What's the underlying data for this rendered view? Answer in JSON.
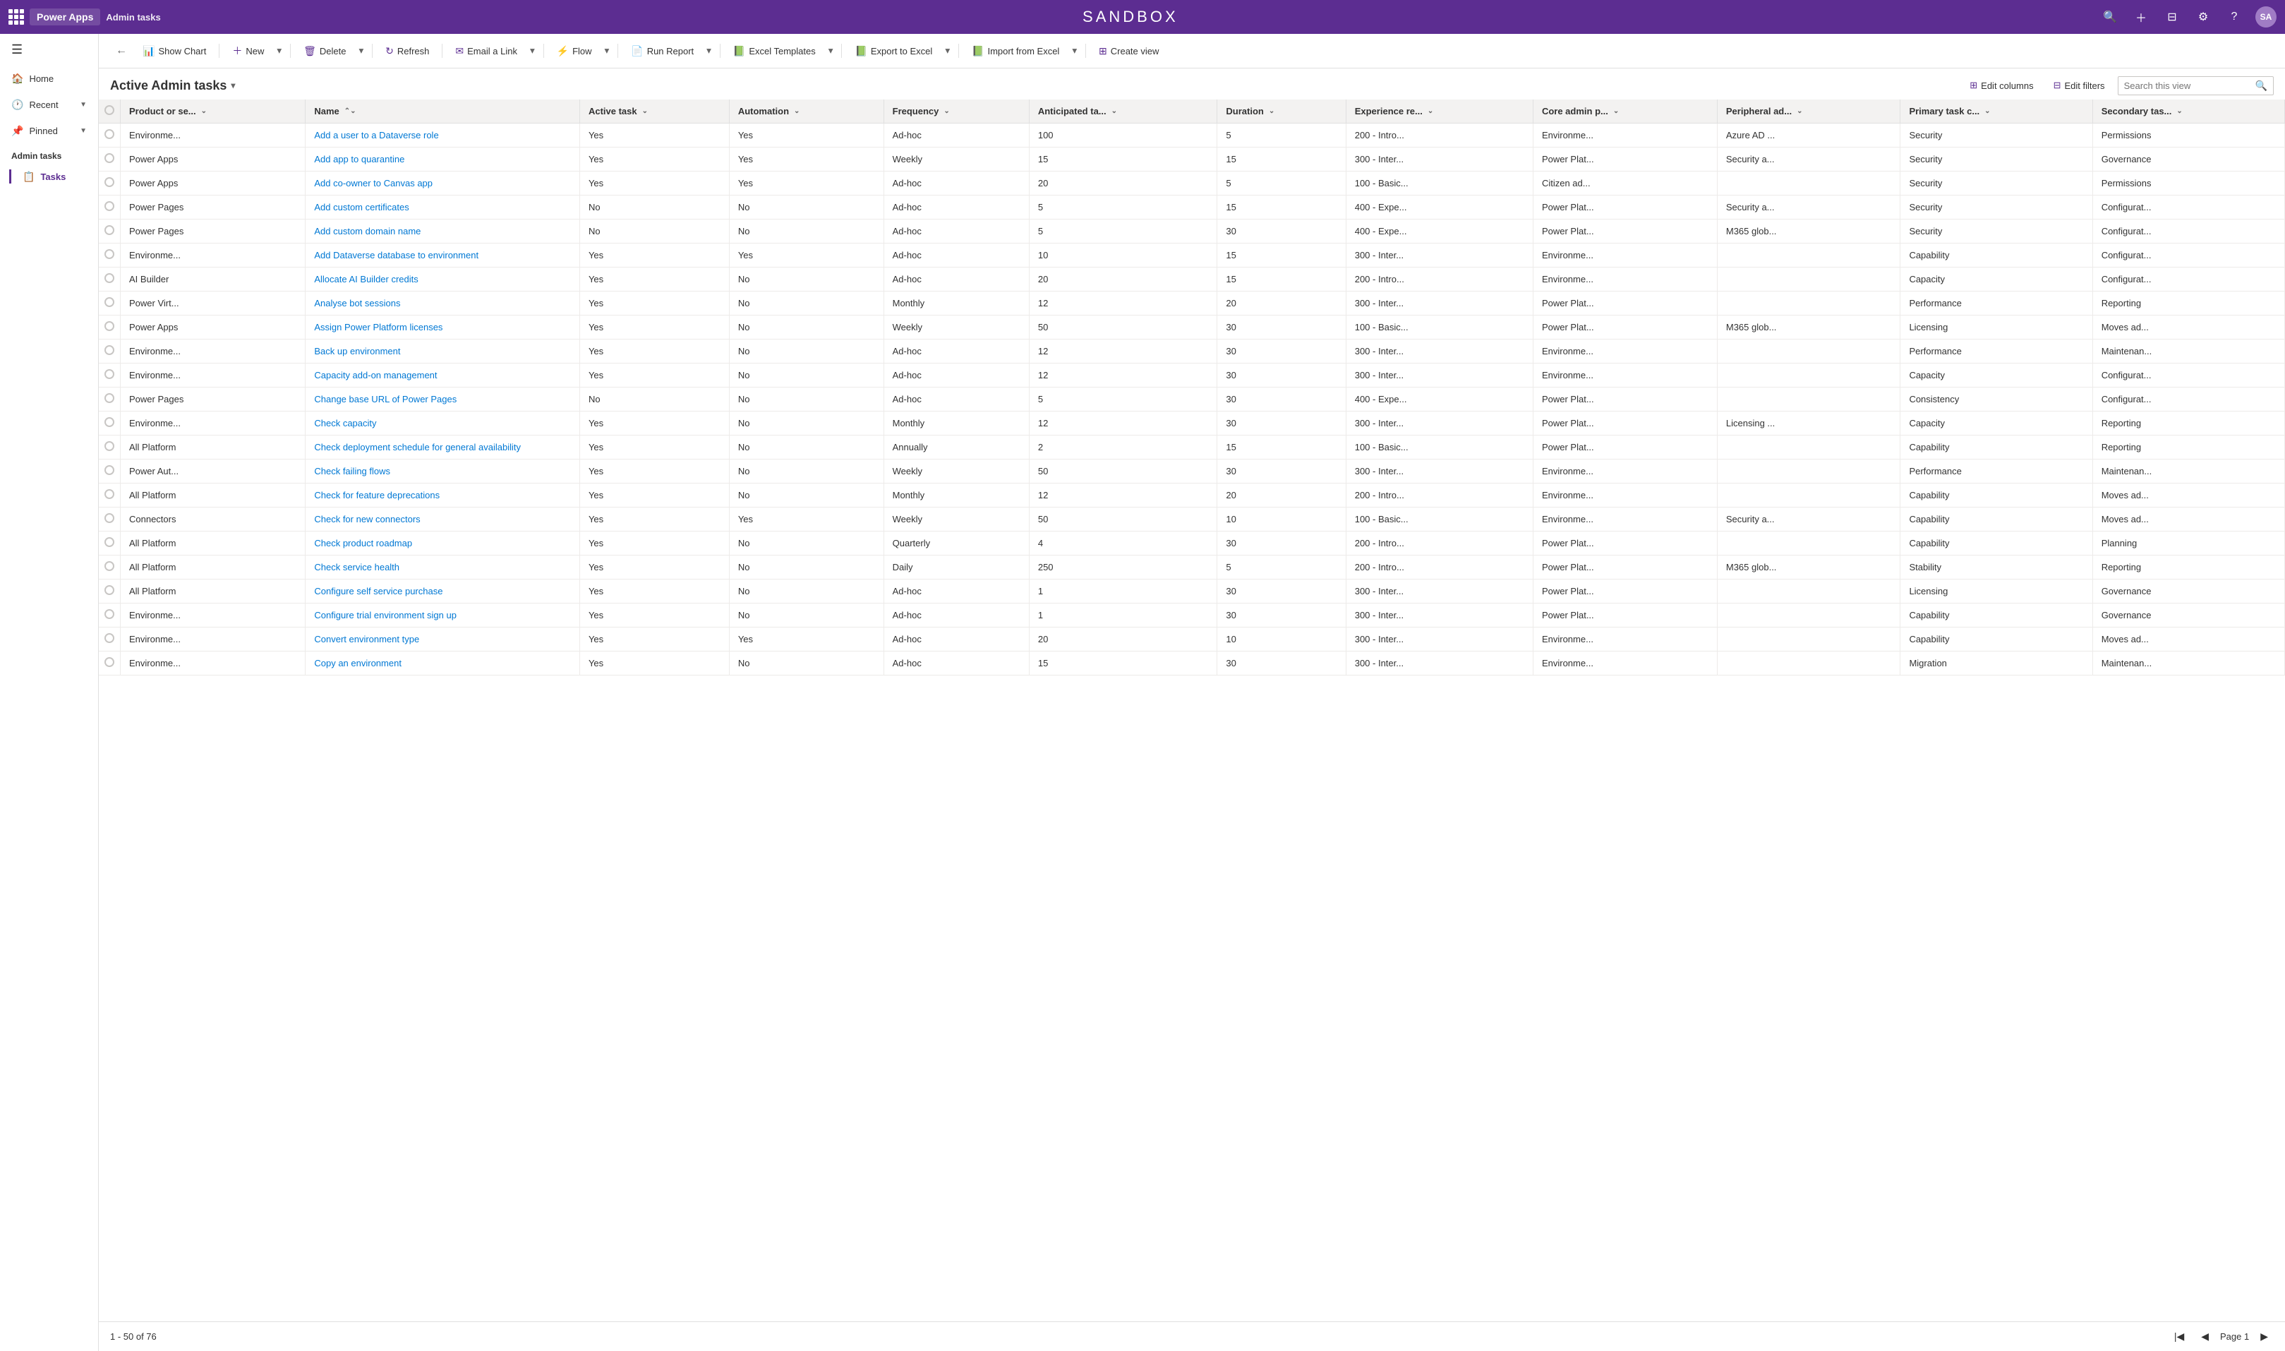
{
  "app": {
    "title": "Power Apps",
    "environment": "SANDBOX",
    "avatar_initials": "SA"
  },
  "topbar": {
    "search_icon": "🔍",
    "add_icon": "+",
    "filter_icon": "⚙",
    "settings_icon": "⚙",
    "help_icon": "?"
  },
  "sidebar": {
    "toggle": "☰",
    "nav_items": [
      {
        "id": "home",
        "icon": "🏠",
        "label": "Home"
      },
      {
        "id": "recent",
        "icon": "🕐",
        "label": "Recent",
        "has_chevron": true
      },
      {
        "id": "pinned",
        "icon": "📌",
        "label": "Pinned",
        "has_chevron": true
      }
    ],
    "section_label": "Admin tasks",
    "sub_items": [
      {
        "id": "tasks",
        "label": "Tasks",
        "active": true,
        "has_icon": true
      }
    ]
  },
  "command_bar": {
    "back": "←",
    "show_chart": "Show Chart",
    "new": "New",
    "delete": "Delete",
    "refresh": "Refresh",
    "email_link": "Email a Link",
    "flow": "Flow",
    "run_report": "Run Report",
    "excel_templates": "Excel Templates",
    "export_to_excel": "Export to Excel",
    "import_from_excel": "Import from Excel",
    "create_view": "Create view"
  },
  "view": {
    "title": "Active Admin tasks",
    "edit_columns": "Edit columns",
    "edit_filters": "Edit filters",
    "search_placeholder": "Search this view"
  },
  "table": {
    "columns": [
      {
        "id": "product",
        "label": "Product or se..."
      },
      {
        "id": "name",
        "label": "Name"
      },
      {
        "id": "active_task",
        "label": "Active task"
      },
      {
        "id": "automation",
        "label": "Automation"
      },
      {
        "id": "frequency",
        "label": "Frequency"
      },
      {
        "id": "anticipated",
        "label": "Anticipated ta..."
      },
      {
        "id": "duration",
        "label": "Duration"
      },
      {
        "id": "experience",
        "label": "Experience re..."
      },
      {
        "id": "core_admin",
        "label": "Core admin p..."
      },
      {
        "id": "peripheral",
        "label": "Peripheral ad..."
      },
      {
        "id": "primary_task",
        "label": "Primary task c..."
      },
      {
        "id": "secondary_task",
        "label": "Secondary tas..."
      }
    ],
    "rows": [
      {
        "product": "Environme...",
        "name": "Add a user to a Dataverse role",
        "active_task": "Yes",
        "automation": "Yes",
        "frequency": "Ad-hoc",
        "anticipated": "100",
        "duration": "5",
        "experience": "200 - Intro...",
        "core_admin": "Environme...",
        "peripheral": "Azure AD ...",
        "primary_task": "Security",
        "secondary_task": "Permissions"
      },
      {
        "product": "Power Apps",
        "name": "Add app to quarantine",
        "active_task": "Yes",
        "automation": "Yes",
        "frequency": "Weekly",
        "anticipated": "15",
        "duration": "15",
        "experience": "300 - Inter...",
        "core_admin": "Power Plat...",
        "peripheral": "Security a...",
        "primary_task": "Security",
        "secondary_task": "Governance"
      },
      {
        "product": "Power Apps",
        "name": "Add co-owner to Canvas app",
        "active_task": "Yes",
        "automation": "Yes",
        "frequency": "Ad-hoc",
        "anticipated": "20",
        "duration": "5",
        "experience": "100 - Basic...",
        "core_admin": "Citizen ad...",
        "peripheral": "",
        "primary_task": "Security",
        "secondary_task": "Permissions"
      },
      {
        "product": "Power Pages",
        "name": "Add custom certificates",
        "active_task": "No",
        "automation": "No",
        "frequency": "Ad-hoc",
        "anticipated": "5",
        "duration": "15",
        "experience": "400 - Expe...",
        "core_admin": "Power Plat...",
        "peripheral": "Security a...",
        "primary_task": "Security",
        "secondary_task": "Configurat..."
      },
      {
        "product": "Power Pages",
        "name": "Add custom domain name",
        "active_task": "No",
        "automation": "No",
        "frequency": "Ad-hoc",
        "anticipated": "5",
        "duration": "30",
        "experience": "400 - Expe...",
        "core_admin": "Power Plat...",
        "peripheral": "M365 glob...",
        "primary_task": "Security",
        "secondary_task": "Configurat..."
      },
      {
        "product": "Environme...",
        "name": "Add Dataverse database to environment",
        "active_task": "Yes",
        "automation": "Yes",
        "frequency": "Ad-hoc",
        "anticipated": "10",
        "duration": "15",
        "experience": "300 - Inter...",
        "core_admin": "Environme...",
        "peripheral": "",
        "primary_task": "Capability",
        "secondary_task": "Configurat..."
      },
      {
        "product": "AI Builder",
        "name": "Allocate AI Builder credits",
        "active_task": "Yes",
        "automation": "No",
        "frequency": "Ad-hoc",
        "anticipated": "20",
        "duration": "15",
        "experience": "200 - Intro...",
        "core_admin": "Environme...",
        "peripheral": "",
        "primary_task": "Capacity",
        "secondary_task": "Configurat..."
      },
      {
        "product": "Power Virt...",
        "name": "Analyse bot sessions",
        "active_task": "Yes",
        "automation": "No",
        "frequency": "Monthly",
        "anticipated": "12",
        "duration": "20",
        "experience": "300 - Inter...",
        "core_admin": "Power Plat...",
        "peripheral": "",
        "primary_task": "Performance",
        "secondary_task": "Reporting"
      },
      {
        "product": "Power Apps",
        "name": "Assign Power Platform licenses",
        "active_task": "Yes",
        "automation": "No",
        "frequency": "Weekly",
        "anticipated": "50",
        "duration": "30",
        "experience": "100 - Basic...",
        "core_admin": "Power Plat...",
        "peripheral": "M365 glob...",
        "primary_task": "Licensing",
        "secondary_task": "Moves ad..."
      },
      {
        "product": "Environme...",
        "name": "Back up environment",
        "active_task": "Yes",
        "automation": "No",
        "frequency": "Ad-hoc",
        "anticipated": "12",
        "duration": "30",
        "experience": "300 - Inter...",
        "core_admin": "Environme...",
        "peripheral": "",
        "primary_task": "Performance",
        "secondary_task": "Maintenan..."
      },
      {
        "product": "Environme...",
        "name": "Capacity add-on management",
        "active_task": "Yes",
        "automation": "No",
        "frequency": "Ad-hoc",
        "anticipated": "12",
        "duration": "30",
        "experience": "300 - Inter...",
        "core_admin": "Environme...",
        "peripheral": "",
        "primary_task": "Capacity",
        "secondary_task": "Configurat..."
      },
      {
        "product": "Power Pages",
        "name": "Change base URL of Power Pages",
        "active_task": "No",
        "automation": "No",
        "frequency": "Ad-hoc",
        "anticipated": "5",
        "duration": "30",
        "experience": "400 - Expe...",
        "core_admin": "Power Plat...",
        "peripheral": "",
        "primary_task": "Consistency",
        "secondary_task": "Configurat..."
      },
      {
        "product": "Environme...",
        "name": "Check capacity",
        "active_task": "Yes",
        "automation": "No",
        "frequency": "Monthly",
        "anticipated": "12",
        "duration": "30",
        "experience": "300 - Inter...",
        "core_admin": "Power Plat...",
        "peripheral": "Licensing ...",
        "primary_task": "Capacity",
        "secondary_task": "Reporting"
      },
      {
        "product": "All Platform",
        "name": "Check deployment schedule for general availability",
        "active_task": "Yes",
        "automation": "No",
        "frequency": "Annually",
        "anticipated": "2",
        "duration": "15",
        "experience": "100 - Basic...",
        "core_admin": "Power Plat...",
        "peripheral": "",
        "primary_task": "Capability",
        "secondary_task": "Reporting"
      },
      {
        "product": "Power Aut...",
        "name": "Check failing flows",
        "active_task": "Yes",
        "automation": "No",
        "frequency": "Weekly",
        "anticipated": "50",
        "duration": "30",
        "experience": "300 - Inter...",
        "core_admin": "Environme...",
        "peripheral": "",
        "primary_task": "Performance",
        "secondary_task": "Maintenan..."
      },
      {
        "product": "All Platform",
        "name": "Check for feature deprecations",
        "active_task": "Yes",
        "automation": "No",
        "frequency": "Monthly",
        "anticipated": "12",
        "duration": "20",
        "experience": "200 - Intro...",
        "core_admin": "Environme...",
        "peripheral": "",
        "primary_task": "Capability",
        "secondary_task": "Moves ad..."
      },
      {
        "product": "Connectors",
        "name": "Check for new connectors",
        "active_task": "Yes",
        "automation": "Yes",
        "frequency": "Weekly",
        "anticipated": "50",
        "duration": "10",
        "experience": "100 - Basic...",
        "core_admin": "Environme...",
        "peripheral": "Security a...",
        "primary_task": "Capability",
        "secondary_task": "Moves ad..."
      },
      {
        "product": "All Platform",
        "name": "Check product roadmap",
        "active_task": "Yes",
        "automation": "No",
        "frequency": "Quarterly",
        "anticipated": "4",
        "duration": "30",
        "experience": "200 - Intro...",
        "core_admin": "Power Plat...",
        "peripheral": "",
        "primary_task": "Capability",
        "secondary_task": "Planning"
      },
      {
        "product": "All Platform",
        "name": "Check service health",
        "active_task": "Yes",
        "automation": "No",
        "frequency": "Daily",
        "anticipated": "250",
        "duration": "5",
        "experience": "200 - Intro...",
        "core_admin": "Power Plat...",
        "peripheral": "M365 glob...",
        "primary_task": "Stability",
        "secondary_task": "Reporting"
      },
      {
        "product": "All Platform",
        "name": "Configure self service purchase",
        "active_task": "Yes",
        "automation": "No",
        "frequency": "Ad-hoc",
        "anticipated": "1",
        "duration": "30",
        "experience": "300 - Inter...",
        "core_admin": "Power Plat...",
        "peripheral": "",
        "primary_task": "Licensing",
        "secondary_task": "Governance"
      },
      {
        "product": "Environme...",
        "name": "Configure trial environment sign up",
        "active_task": "Yes",
        "automation": "No",
        "frequency": "Ad-hoc",
        "anticipated": "1",
        "duration": "30",
        "experience": "300 - Inter...",
        "core_admin": "Power Plat...",
        "peripheral": "",
        "primary_task": "Capability",
        "secondary_task": "Governance"
      },
      {
        "product": "Environme...",
        "name": "Convert environment type",
        "active_task": "Yes",
        "automation": "Yes",
        "frequency": "Ad-hoc",
        "anticipated": "20",
        "duration": "10",
        "experience": "300 - Inter...",
        "core_admin": "Environme...",
        "peripheral": "",
        "primary_task": "Capability",
        "secondary_task": "Moves ad..."
      },
      {
        "product": "Environme...",
        "name": "Copy an environment",
        "active_task": "Yes",
        "automation": "No",
        "frequency": "Ad-hoc",
        "anticipated": "15",
        "duration": "30",
        "experience": "300 - Inter...",
        "core_admin": "Environme...",
        "peripheral": "",
        "primary_task": "Migration",
        "secondary_task": "Maintenan..."
      }
    ]
  },
  "footer": {
    "record_count": "1 - 50 of 76",
    "page_label": "Page 1"
  }
}
